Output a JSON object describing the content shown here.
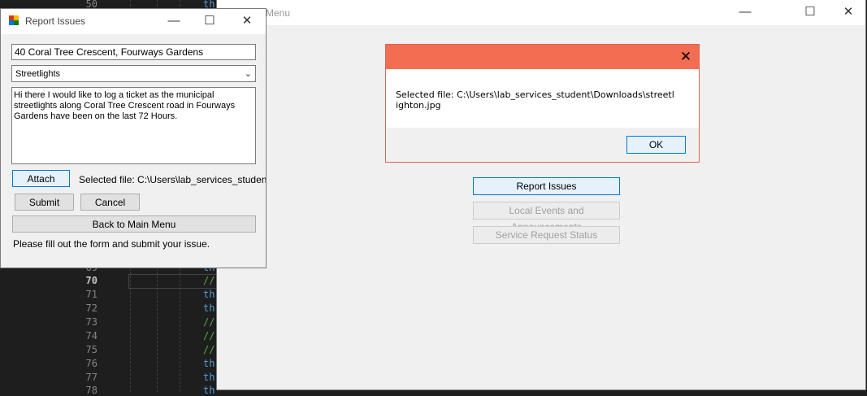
{
  "editor": {
    "lines": [
      {
        "n": "50",
        "code": "th",
        "kind": "kw"
      },
      {
        "n": "69",
        "code": "th",
        "kind": "kw"
      },
      {
        "n": "70",
        "code": "//",
        "kind": "cm"
      },
      {
        "n": "71",
        "code": "th",
        "kind": "kw"
      },
      {
        "n": "72",
        "code": "th",
        "kind": "kw"
      },
      {
        "n": "73",
        "code": "//",
        "kind": "cm"
      },
      {
        "n": "74",
        "code": "//",
        "kind": "cm"
      },
      {
        "n": "75",
        "code": "//",
        "kind": "cm"
      },
      {
        "n": "76",
        "code": "th",
        "kind": "kw"
      },
      {
        "n": "77",
        "code": "th",
        "kind": "kw"
      },
      {
        "n": "78",
        "code": "th",
        "kind": "kw"
      }
    ]
  },
  "main_window": {
    "title": "Menu",
    "buttons": {
      "report": "Report Issues",
      "events": "Local Events and Announcements",
      "status": "Service Request Status"
    }
  },
  "message_box": {
    "text": "Selected file: C:\\Users\\lab_services_student\\Downloads\\streetlighton.jpg",
    "ok": "OK"
  },
  "report_window": {
    "title": "Report Issues",
    "location": "40 Coral Tree Crescent, Fourways Gardens",
    "category": "Streetlights",
    "description": "Hi there I would like to log a ticket as the municipal streetlights along Coral Tree Crescent road in Fourways Gardens have been on the last 72 Hours.",
    "attach": "Attach",
    "selected_file": "Selected file: C:\\Users\\lab_services_student\\Downloads\\streetlighton.jpg",
    "submit": "Submit",
    "cancel": "Cancel",
    "back": "Back to Main Menu",
    "status": "Please fill out the form and submit your issue."
  },
  "colors": {
    "accent": "#0078d7",
    "msgbox_header": "#f26d52"
  }
}
